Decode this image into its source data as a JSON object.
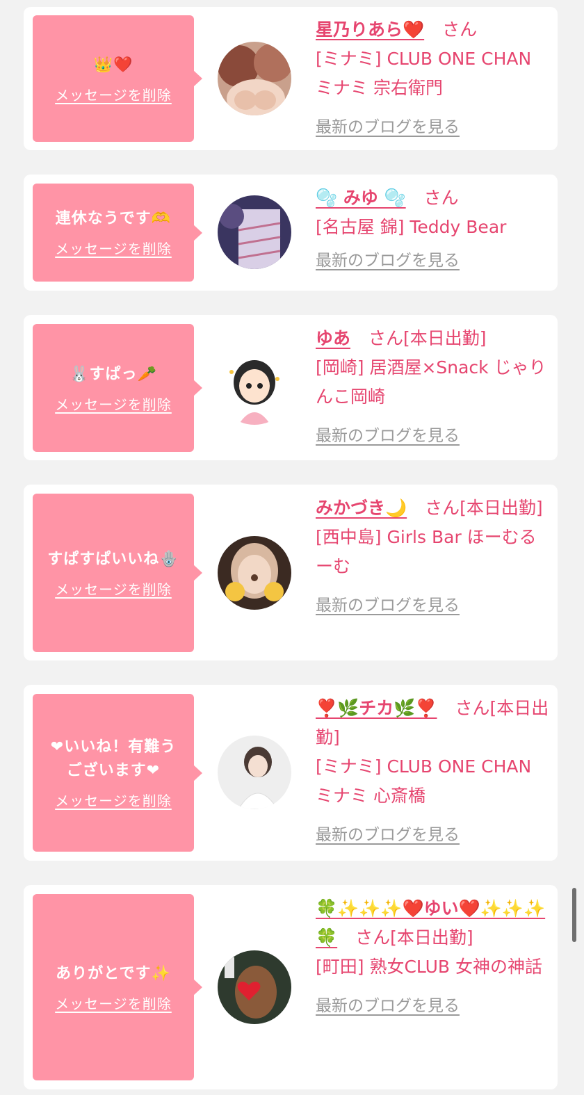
{
  "cards": [
    {
      "message": "👑❤️",
      "delete_label": "メッセージを削除",
      "name": "星乃りあら❤️",
      "san": "さん",
      "shop": "[ミナミ] CLUB ONE CHAN ミナミ 宗右衛門",
      "blog_link": "最新のブログを見る"
    },
    {
      "message": "連休なうです🫶",
      "delete_label": "メッセージを削除",
      "name": "🫧 みゆ 🫧",
      "san": "さん",
      "shop": "[名古屋 錦] Teddy Bear",
      "blog_link": "最新のブログを見る"
    },
    {
      "message": "🐰すぱっ🥕",
      "delete_label": "メッセージを削除",
      "name": "ゆあ",
      "san": "さん[本日出勤]",
      "shop": "[岡崎] 居酒屋×Snack じゃりんこ岡崎",
      "blog_link": "最新のブログを見る"
    },
    {
      "message": "すぱすぱいいね🪬",
      "delete_label": "メッセージを削除",
      "name": "みかづき🌙",
      "san": "さん[本日出勤]",
      "shop": "[西中島] Girls Bar ほーむるーむ",
      "blog_link": "最新のブログを見る"
    },
    {
      "message": "❤いいね！有難うございます❤",
      "delete_label": "メッセージを削除",
      "name": "❣️🌿チカ🌿❣️",
      "san": "さん[本日出勤]",
      "shop": "[ミナミ] CLUB ONE CHAN ミナミ 心斎橋",
      "blog_link": "最新のブログを見る"
    },
    {
      "message": "ありがとです✨",
      "delete_label": "メッセージを削除",
      "name": "🍀✨✨✨❤️ゆい❤️✨✨✨🍀",
      "san": "さん[本日出勤]",
      "shop": "[町田] 熟女CLUB 女神の神話",
      "blog_link": "最新のブログを見る"
    }
  ]
}
